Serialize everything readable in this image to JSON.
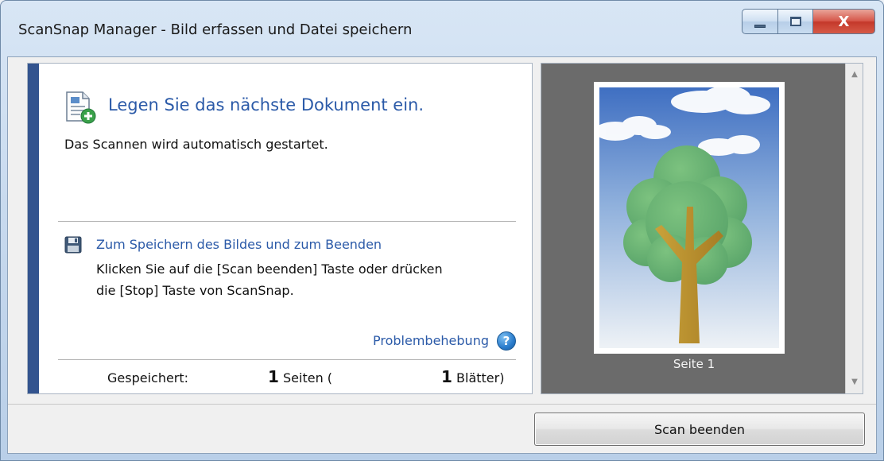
{
  "window": {
    "title": "ScanSnap Manager - Bild erfassen und Datei speichern",
    "close_glyph": "X"
  },
  "main": {
    "heading": "Legen Sie das nächste Dokument ein.",
    "subtext": "Das Scannen wird automatisch gestartet.",
    "save_heading": "Zum Speichern des Bildes und zum Beenden",
    "save_line1": "Klicken Sie auf die [Scan beenden] Taste oder drücken",
    "save_line2": "die [Stop] Taste von ScanSnap.",
    "troubleshooting": "Problembehebung",
    "help_glyph": "?"
  },
  "status": {
    "label": "Gespeichert:",
    "pages_count": "1",
    "pages_text": "Seiten (",
    "sheets_count": "1",
    "sheets_text": "Blätter)"
  },
  "preview": {
    "caption": "Seite 1"
  },
  "buttons": {
    "scan_end": "Scan beenden"
  },
  "colors": {
    "accent_bar": "#33548f",
    "link_blue": "#2b5aa8",
    "preview_bg": "#6b6b6b"
  }
}
